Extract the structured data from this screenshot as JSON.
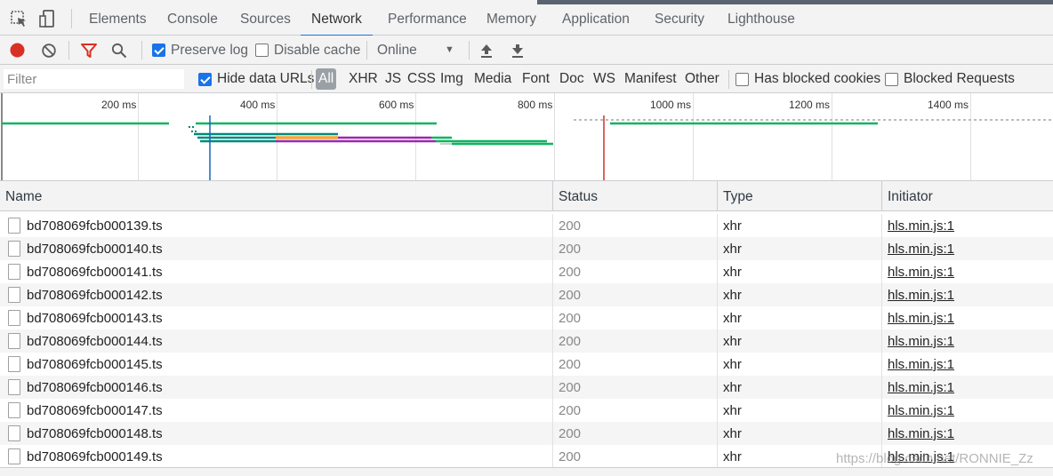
{
  "tabs": [
    {
      "label": "Elements"
    },
    {
      "label": "Console"
    },
    {
      "label": "Sources"
    },
    {
      "label": "Network",
      "active": true
    },
    {
      "label": "Performance"
    },
    {
      "label": "Memory"
    },
    {
      "label": "Application"
    },
    {
      "label": "Security"
    },
    {
      "label": "Lighthouse"
    }
  ],
  "toolbar": {
    "preserve_log": {
      "label": "Preserve log",
      "checked": true
    },
    "disable_cache": {
      "label": "Disable cache",
      "checked": false
    },
    "throttling": {
      "value": "Online"
    }
  },
  "filter": {
    "placeholder": "Filter",
    "hide_data_urls": {
      "label": "Hide data URLs",
      "checked": true
    },
    "types": [
      "All",
      "XHR",
      "JS",
      "CSS",
      "Img",
      "Media",
      "Font",
      "Doc",
      "WS",
      "Manifest",
      "Other"
    ],
    "active_type": "All",
    "has_blocked_cookies": {
      "label": "Has blocked cookies",
      "checked": false
    },
    "blocked_requests": {
      "label": "Blocked Requests",
      "checked": false
    }
  },
  "overview": {
    "ticks": [
      "200 ms",
      "400 ms",
      "600 ms",
      "800 ms",
      "1000 ms",
      "1200 ms",
      "1400 ms"
    ]
  },
  "table": {
    "columns": [
      "Name",
      "Status",
      "Type",
      "Initiator"
    ],
    "rows": [
      {
        "name": "bd708069fcb000139.ts",
        "status": "200",
        "type": "xhr",
        "initiator": "hls.min.js:1"
      },
      {
        "name": "bd708069fcb000140.ts",
        "status": "200",
        "type": "xhr",
        "initiator": "hls.min.js:1"
      },
      {
        "name": "bd708069fcb000141.ts",
        "status": "200",
        "type": "xhr",
        "initiator": "hls.min.js:1"
      },
      {
        "name": "bd708069fcb000142.ts",
        "status": "200",
        "type": "xhr",
        "initiator": "hls.min.js:1"
      },
      {
        "name": "bd708069fcb000143.ts",
        "status": "200",
        "type": "xhr",
        "initiator": "hls.min.js:1"
      },
      {
        "name": "bd708069fcb000144.ts",
        "status": "200",
        "type": "xhr",
        "initiator": "hls.min.js:1"
      },
      {
        "name": "bd708069fcb000145.ts",
        "status": "200",
        "type": "xhr",
        "initiator": "hls.min.js:1"
      },
      {
        "name": "bd708069fcb000146.ts",
        "status": "200",
        "type": "xhr",
        "initiator": "hls.min.js:1"
      },
      {
        "name": "bd708069fcb000147.ts",
        "status": "200",
        "type": "xhr",
        "initiator": "hls.min.js:1"
      },
      {
        "name": "bd708069fcb000148.ts",
        "status": "200",
        "type": "xhr",
        "initiator": "hls.min.js:1"
      },
      {
        "name": "bd708069fcb000149.ts",
        "status": "200",
        "type": "xhr",
        "initiator": "hls.min.js:1"
      }
    ]
  },
  "watermark": "https://blog.csdn.net/RONNIE_Zz",
  "colors": {
    "accent": "#1a73e8",
    "record": "#d93025",
    "filter_icon": "#d93025",
    "waterfall_green": "#0eb45f",
    "waterfall_teal": "#00897b",
    "waterfall_orange": "#f4a638",
    "waterfall_purple": "#9c27b0",
    "load_line": "#d32f2f",
    "dom_line": "#1565c0"
  }
}
